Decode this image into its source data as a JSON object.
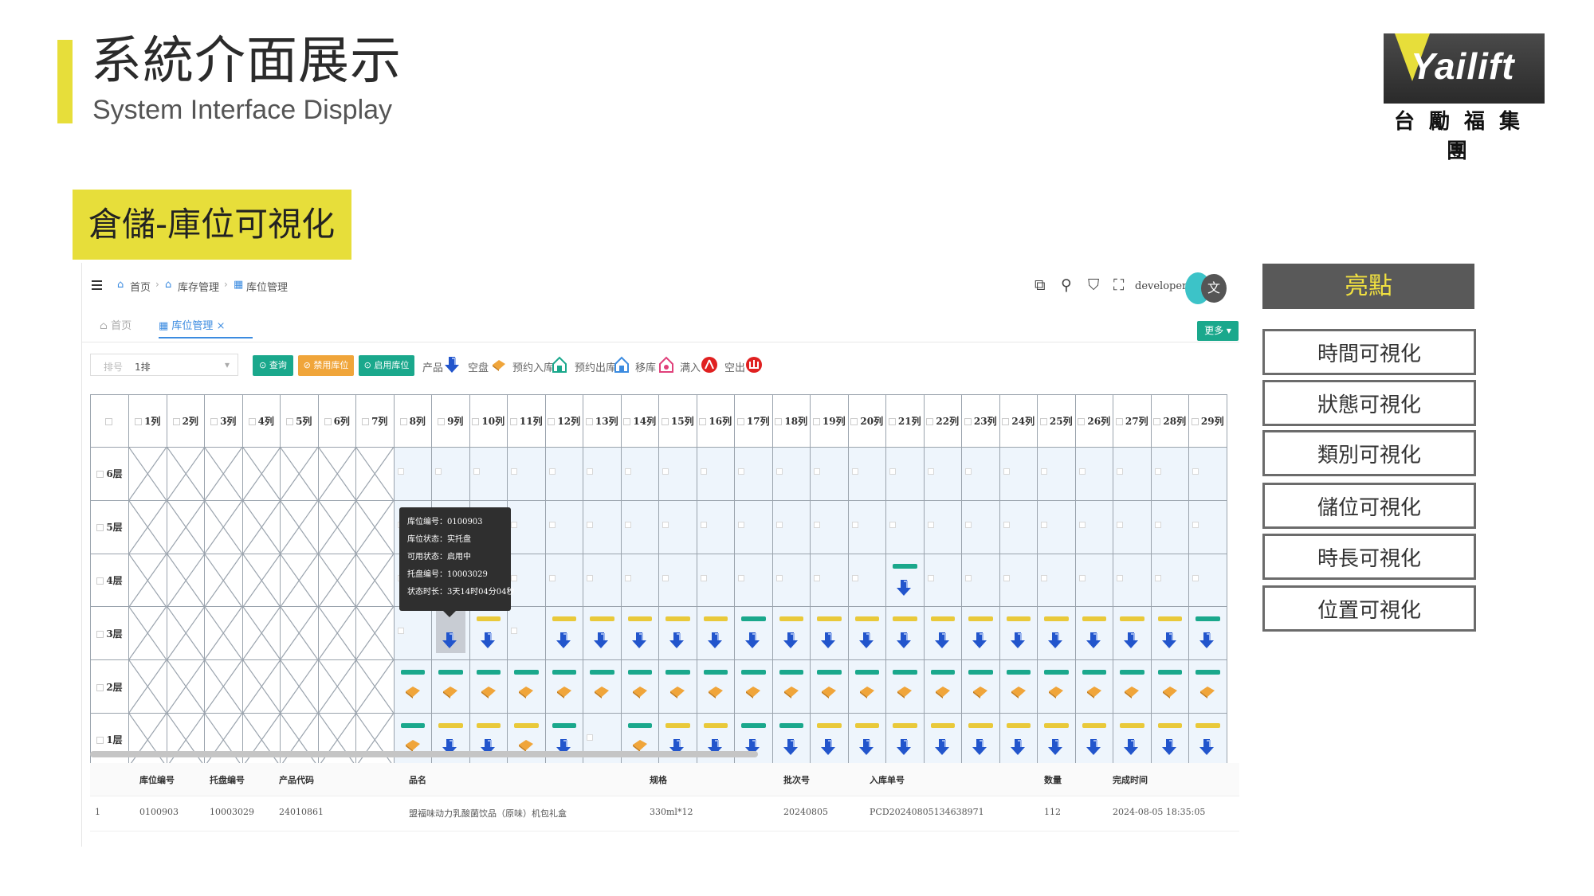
{
  "slide": {
    "title_cn": "系統介面展示",
    "title_en": "System Interface Display",
    "section": "倉儲-庫位可視化",
    "logo": {
      "text": "Yailift",
      "cn": "台勵福集團",
      "accent": "#e7de3a"
    }
  },
  "app": {
    "breadcrumb": [
      "首页",
      "库存管理",
      "库位管理"
    ],
    "user": "developer",
    "avatar_label": "文",
    "tabs": [
      {
        "label": "首页"
      },
      {
        "label": "库位管理",
        "close": "×"
      }
    ],
    "more_label": "更多 ▾",
    "filter": {
      "label": "排号",
      "value": "1排",
      "arrow": "▾"
    },
    "buttons": {
      "query": "⊙ 查询",
      "disable": "⊘ 禁用库位",
      "enable": "⊙ 启用库位"
    },
    "legend": [
      "产品",
      "空盘",
      "预约入库",
      "预约出库",
      "移库",
      "满入",
      "空出"
    ],
    "colors": {
      "teal": "#1aa88c",
      "orange": "#f0a53a",
      "yellow": "#e9c93a",
      "blue": "#2255cc",
      "bg": "#eef5fc"
    }
  },
  "grid": {
    "columns": [
      "1列",
      "2列",
      "3列",
      "4列",
      "5列",
      "6列",
      "7列",
      "8列",
      "9列",
      "10列",
      "11列",
      "12列",
      "13列",
      "14列",
      "15列",
      "16列",
      "17列",
      "18列",
      "19列",
      "20列",
      "21列",
      "22列",
      "23列",
      "24列",
      "25列",
      "26列",
      "27列",
      "28列",
      "29列"
    ],
    "rows": [
      "6层",
      "5层",
      "4层",
      "3层",
      "2层",
      "1层"
    ],
    "disabled_columns": 7,
    "cells": {
      "6层": [
        "",
        "",
        "",
        "",
        "",
        "",
        "",
        "",
        "",
        "",
        "",
        "",
        "",
        "",
        "",
        "",
        "",
        "",
        "",
        "",
        "",
        ""
      ],
      "5层": [
        "",
        "",
        "",
        "",
        "",
        "",
        "",
        "",
        "",
        "",
        "",
        "",
        "",
        "",
        "",
        "",
        "",
        "",
        "",
        "",
        "",
        ""
      ],
      "4层": [
        "",
        "",
        "",
        "",
        "",
        "",
        "",
        "",
        "",
        "",
        "",
        "",
        "",
        "g:p",
        "",
        "",
        "",
        "",
        "",
        "",
        "",
        ""
      ],
      "3层": [
        "",
        "sel:p",
        "y:p",
        "",
        "y:p",
        "y:p",
        "y:p",
        "y:p",
        "y:p",
        "g:p",
        "y:p",
        "y:p",
        "y:p",
        "y:p",
        "y:p",
        "y:p",
        "y:p",
        "y:p",
        "y:p",
        "y:p",
        "y:p",
        "g:p"
      ],
      "2层": [
        "g:e",
        "g:e",
        "g:e",
        "g:e",
        "g:e",
        "g:e",
        "g:e",
        "g:e",
        "g:e",
        "g:e",
        "g:e",
        "g:e",
        "g:e",
        "g:e",
        "g:e",
        "g:e",
        "g:e",
        "g:e",
        "g:e",
        "g:e",
        "g:e",
        "g:e"
      ],
      "1层": [
        "g:e",
        "y:p",
        "y:p",
        "y:e",
        "g:p",
        "",
        "g:e",
        "y:p",
        "y:p",
        "g:p",
        "g:p",
        "y:p",
        "y:p",
        "y:p",
        "y:p",
        "y:p",
        "y:p",
        "y:p",
        "y:p",
        "y:p",
        "y:p",
        "y:p"
      ]
    }
  },
  "tooltip": [
    "库位编号：0100903",
    "库位状态：实托盘",
    "可用状态：启用中",
    "托盘编号：10003029",
    "状态时长：3天14时04分04秒"
  ],
  "details": {
    "headers": [
      "库位编号",
      "托盘编号",
      "产品代码",
      "品名",
      "规格",
      "批次号",
      "入库单号",
      "数量",
      "完成时间"
    ],
    "rows": [
      [
        "1",
        "0100903",
        "10003029",
        "24010861",
        "盟福味动力乳酸菌饮品（原味）机包礼盒",
        "330ml*12",
        "20240805",
        "PCD20240805134638971",
        "112",
        "2024-08-05 18:35:05"
      ]
    ]
  },
  "highlights": {
    "title": "亮點",
    "items": [
      "時間可視化",
      "狀態可視化",
      "類別可視化",
      "儲位可視化",
      "時長可視化",
      "位置可視化"
    ]
  }
}
